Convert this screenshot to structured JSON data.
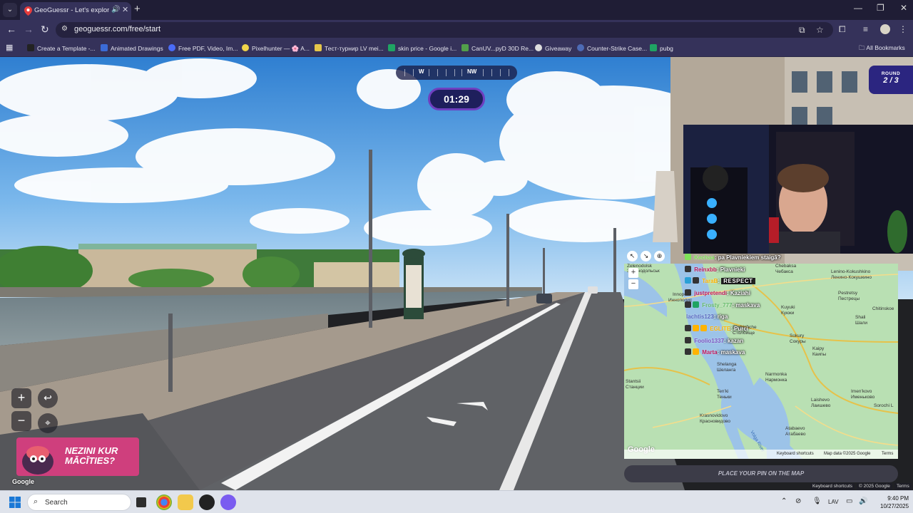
{
  "browser": {
    "tab_title": "GeoGuessr - Let's explore t",
    "url": "geoguessr.com/free/start",
    "bookmarks": [
      {
        "label": "Create a Template -...",
        "color": "#222222"
      },
      {
        "label": "Animated Drawings",
        "color": "#3b6bd6"
      },
      {
        "label": "Free PDF, Video, Im...",
        "color": "#4a6cf7"
      },
      {
        "label": "Pixelhunter — 🌸 A...",
        "color": "#f1d54a"
      },
      {
        "label": "Тест-турнир LV mei...",
        "color": "#e5c64a"
      },
      {
        "label": "skin price - Google i...",
        "color": "#1fa463"
      },
      {
        "label": "CanUV...pyD 30D Re...",
        "color": "#52a04a"
      },
      {
        "label": "Giveaway",
        "color": "#dddddd"
      },
      {
        "label": "Counter-Strike Case...",
        "color": "#4d6bb5"
      },
      {
        "label": "pubg",
        "color": "#1fa463"
      }
    ],
    "all_bookmarks": "All Bookmarks"
  },
  "game": {
    "compass": [
      "W",
      "NW"
    ],
    "timer": "01:29",
    "round_label": "ROUND",
    "round_value": "2 / 3",
    "ad_text": "NEZINI KUR MĀCĪTIES?",
    "google_watermark": "Google",
    "place_pin": "PLACE YOUR PIN ON THE MAP",
    "map_footer": {
      "shortcuts": "Keyboard shortcuts",
      "data": "Map data ©2025 Google",
      "terms": "Terms",
      "shortcuts2": "Keyboard shortcuts",
      "copyright": "© 2025 Google",
      "terms2": "Terms"
    },
    "map_towns": [
      "Zelenodolsk",
      "Зеленодольськ",
      "Chebaksa",
      "Чебакса",
      "Lenino-Kokushkino",
      "Ленино-Кокушкино",
      "Innopolis",
      "Иннополис",
      "Kuyuki",
      "Куюки",
      "Pestretsy",
      "Пестрецы",
      "Shali",
      "Шали",
      "Chitinskoe",
      "Stolbishche",
      "Столбище",
      "Sokury",
      "Сокуры",
      "Kaipy",
      "Каипы",
      "Shelanga",
      "Шеланга",
      "Narmonka",
      "Нармонка",
      "Stantsii",
      "Станции",
      "Ten'ki",
      "Теньки",
      "Laishevo",
      "Лаишево",
      "Imen'kovo",
      "Именьково",
      "Sorochi L",
      "Krasnovidovo",
      "Красновидово",
      "Atabaevo",
      "Атабаево",
      "Volga River",
      "Google"
    ],
    "chat": [
      {
        "user": "Kechaa",
        "msg": "pa Plavniekiem staigā?",
        "color": "#7fe35a"
      },
      {
        "user": "Reinxbb",
        "msg": "Plavnieki",
        "color": "#c2185b"
      },
      {
        "user": "TaraB",
        "msg": "RESPECT",
        "color": "#ffb300"
      },
      {
        "user": "justpretendi",
        "msg": "Kaziahi",
        "color": "#c2185b"
      },
      {
        "user": "Frosty_777",
        "msg": "maskava",
        "color": "#66bb6a"
      },
      {
        "user": "lachtis123",
        "msg": "riga",
        "color": "#5c6bc0"
      },
      {
        "user": "EGLITE",
        "msg": "Purci",
        "color": "#ffb300"
      },
      {
        "user": "Foolio1337",
        "msg": "kazan",
        "color": "#7e57c2"
      },
      {
        "user": "Marta",
        "msg": "maskava",
        "color": "#c2185b"
      }
    ]
  },
  "taskbar": {
    "search": "Search",
    "lang": "LAV",
    "time": "9:40 PM",
    "date": "10/27/2025"
  }
}
